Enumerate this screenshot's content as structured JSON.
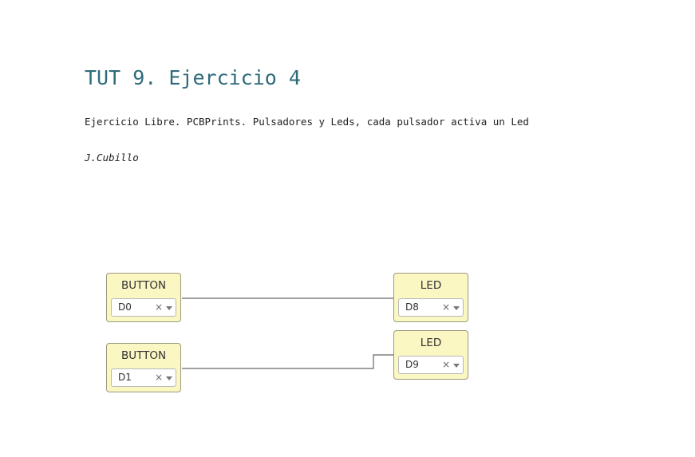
{
  "page": {
    "title": "TUT 9. Ejercicio 4",
    "description": "Ejercicio Libre. PCBPrints. Pulsadores y Leds, cada pulsador activa un Led",
    "author": "J.Cubillo"
  },
  "diagram": {
    "blocks": [
      {
        "label": "BUTTON",
        "pin": "D0",
        "clear_glyph": "×"
      },
      {
        "label": "BUTTON",
        "pin": "D1",
        "clear_glyph": "×"
      },
      {
        "label": "LED",
        "pin": "D8",
        "clear_glyph": "×"
      },
      {
        "label": "LED",
        "pin": "D9",
        "clear_glyph": "×"
      }
    ],
    "colors": {
      "block_fill": "#fbf7c3",
      "block_border": "#9b9a7e",
      "wire": "#666666",
      "title": "#2e6b7a"
    }
  }
}
